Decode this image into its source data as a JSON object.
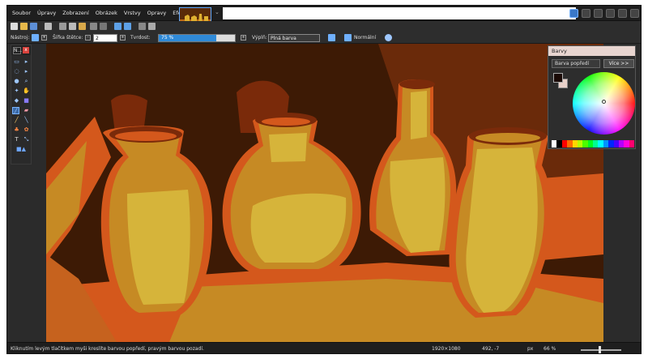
{
  "menubar": {
    "items": [
      "Soubor",
      "Úpravy",
      "Zobrazení",
      "Obrázek",
      "Vrstvy",
      "Opravy",
      "Efekty"
    ]
  },
  "options_bar": {
    "tool_label": "Nástroj:",
    "brush_width_label": "Šířka štětce:",
    "brush_width_value": "2",
    "hardness_label": "Tvrdost:",
    "hardness_value": "75 %",
    "hardness_fraction": 0.75,
    "fill_label": "Výplň:",
    "fill_value": "Plná barva",
    "blend_value": "Normální"
  },
  "tools_panel": {
    "tab_label": "N..."
  },
  "colors_panel": {
    "title": "Barvy",
    "mode": "Barva popředí",
    "more_button": "Více >>",
    "primary_color": "#1a0a06",
    "secondary_color": "#e8d0c8",
    "palette": [
      "#ffffff",
      "#000000",
      "#ff0000",
      "#ff6a00",
      "#ffd800",
      "#b6ff00",
      "#4cff00",
      "#00ff21",
      "#00ff90",
      "#00ffff",
      "#0094ff",
      "#0026ff",
      "#4800ff",
      "#b200ff",
      "#ff00dc",
      "#ff006e"
    ]
  },
  "status_bar": {
    "hint": "Kliknutím levým tlačítkem myši kreslíte barvou popředí, pravým barvou pozadí.",
    "image_size": "1920×1080",
    "cursor_pos": "492, -7",
    "units": "px",
    "zoom": "66 %"
  },
  "colors": {
    "accent": "#2f8ad8",
    "bg_dark": "#2b2b2b",
    "canvas_dark_brown": "#3d1a05",
    "canvas_orange": "#d4581c",
    "canvas_ochre": "#c68a24",
    "canvas_yellow": "#d6b43a"
  }
}
